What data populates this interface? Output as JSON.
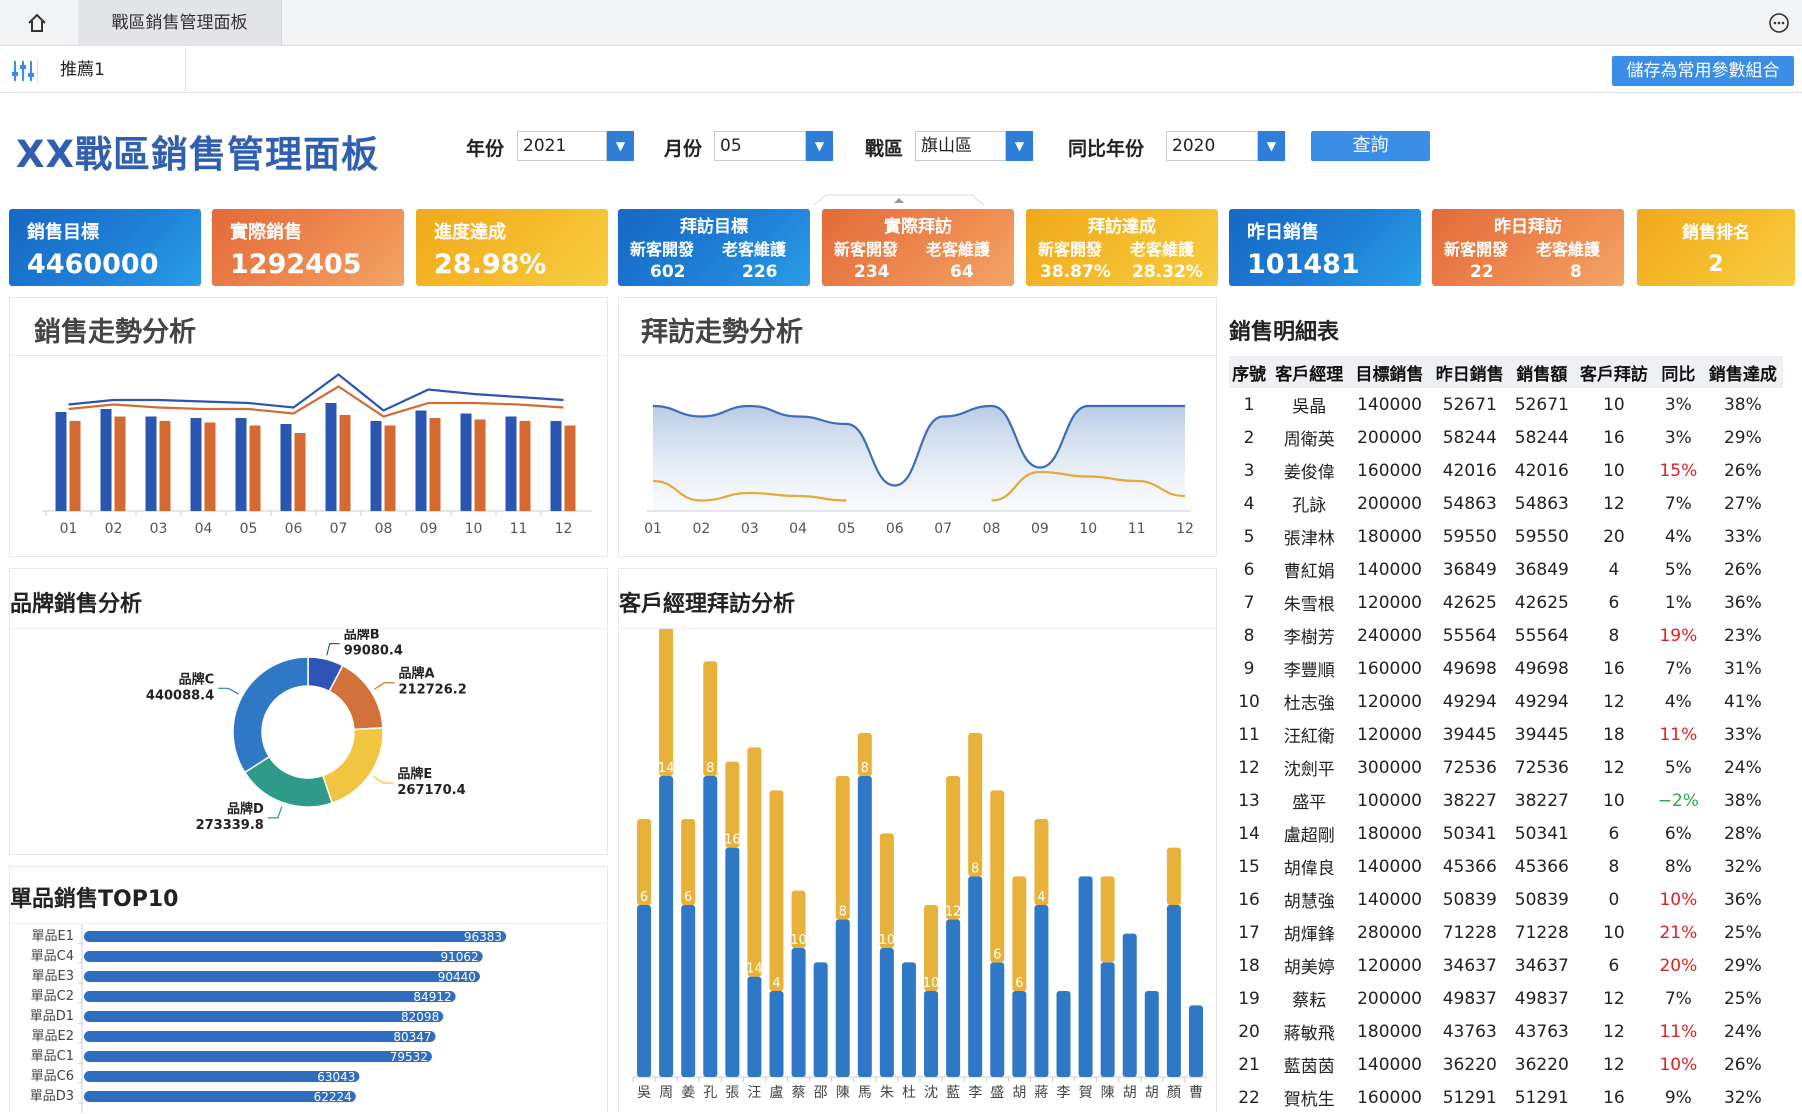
{
  "tabbar": {
    "tab_label": "戰區銷售管理面板"
  },
  "parambar": {
    "tab_label": "推薦1",
    "save_label": "儲存為常用參數組合"
  },
  "page_title": "XX戰區銷售管理面板",
  "filters": {
    "year_label": "年份",
    "year_value": "2021",
    "month_label": "月份",
    "month_value": "05",
    "region_label": "戰區",
    "region_value": "旗山區",
    "compare_label": "同比年份",
    "compare_value": "2020",
    "query_label": "查詢"
  },
  "kpis": {
    "target": {
      "title": "銷售目標",
      "value": "4460000"
    },
    "actual": {
      "title": "實際銷售",
      "value": "1292405"
    },
    "progress": {
      "title": "進度達成",
      "value": "28.98%"
    },
    "visit_target": {
      "title": "拜訪目標",
      "sub1": "新客開發",
      "sub2": "老客維護",
      "v1": "602",
      "v2": "226"
    },
    "visit_actual": {
      "title": "實際拜訪",
      "sub1": "新客開發",
      "sub2": "老客維護",
      "v1": "234",
      "v2": "64"
    },
    "visit_rate": {
      "title": "拜訪達成",
      "sub1": "新客開發",
      "sub2": "老客維護",
      "v1": "38.87%",
      "v2": "28.32%"
    },
    "yesterday": {
      "title": "昨日銷售",
      "value": "101481"
    },
    "yesterday_visit": {
      "title": "昨日拜訪",
      "sub1": "新客開發",
      "sub2": "老客維護",
      "v1": "22",
      "v2": "8"
    },
    "rank": {
      "title": "銷售排名",
      "value": "2"
    }
  },
  "colors": {
    "blue": "#2a55b0",
    "orange": "#d46a32",
    "gold": "#e8b23a",
    "barblue": "#2f78c6"
  },
  "panels": {
    "sales_trend": "銷售走勢分析",
    "visit_trend": "拜訪走勢分析",
    "brand": "品牌銷售分析",
    "manager_visit": "客戶經理拜訪分析",
    "top10": "單品銷售TOP10",
    "detail": "銷售明細表"
  },
  "chart_data": [
    {
      "type": "bar",
      "id": "sales_trend",
      "categories": [
        "01",
        "02",
        "03",
        "04",
        "05",
        "06",
        "07",
        "08",
        "09",
        "10",
        "11",
        "12"
      ],
      "series": [
        {
          "values": [
            66,
            68,
            63,
            62,
            62,
            58,
            72,
            60,
            67,
            65,
            63,
            60
          ]
        },
        {
          "values": [
            60,
            63,
            60,
            59,
            57,
            52,
            64,
            57,
            62,
            61,
            60,
            57
          ]
        }
      ],
      "lines": [
        {
          "values": [
            71,
            74,
            74,
            73,
            72,
            69,
            91,
            67,
            81,
            78,
            76,
            74
          ]
        },
        {
          "values": [
            68,
            71,
            69,
            68,
            68,
            65,
            83,
            63,
            72,
            72,
            71,
            69
          ]
        }
      ],
      "ylim": [
        0,
        100
      ]
    },
    {
      "type": "area",
      "id": "visit_trend",
      "categories": [
        "01",
        "02",
        "03",
        "04",
        "05",
        "06",
        "07",
        "08",
        "09",
        "10",
        "11",
        "12"
      ],
      "series": [
        {
          "values": [
            70,
            63,
            70,
            63,
            58,
            17,
            63,
            70,
            29,
            70,
            70,
            70
          ]
        },
        {
          "values": [
            20,
            7,
            12,
            10,
            7,
            null,
            null,
            7,
            26,
            23,
            20,
            10
          ]
        }
      ],
      "ylim": [
        0,
        100
      ]
    },
    {
      "type": "pie",
      "id": "brand",
      "labels": [
        "品牌B",
        "品牌A",
        "品牌E",
        "品牌D",
        "品牌C"
      ],
      "values": [
        99080.4,
        212726.2,
        267170.4,
        273339.8,
        440088.4
      ],
      "label_text": [
        "99080.4",
        "212726.2",
        "267170.4",
        "273339.8",
        "440088.4"
      ],
      "colors": [
        "#2f54b8",
        "#d2723a",
        "#f0c540",
        "#2e9a8a",
        "#2f78c6"
      ]
    },
    {
      "type": "bar",
      "id": "top10",
      "orientation": "horizontal",
      "categories": [
        "單品E1",
        "單品C4",
        "單品E3",
        "單品C2",
        "單品D1",
        "單品E2",
        "單品C1",
        "單品C6",
        "單品D3"
      ],
      "values": [
        96383,
        91062,
        90440,
        84912,
        82098,
        80347,
        79532,
        63043,
        62224
      ],
      "xlim": [
        0,
        100000
      ]
    },
    {
      "type": "bar",
      "id": "manager_visit",
      "stacked": true,
      "categories": [
        "吳",
        "周",
        "姜",
        "孔",
        "張",
        "汪",
        "盧",
        "蔡",
        "邵",
        "陳",
        "馬",
        "朱",
        "杜",
        "沈",
        "藍",
        "李",
        "盛",
        "胡",
        "蔣",
        "李",
        "賀",
        "陳",
        "胡",
        "胡",
        "顏",
        "曹"
      ],
      "series": [
        {
          "name": "",
          "values": [
            12,
            21,
            12,
            21,
            16,
            7,
            6,
            9,
            8,
            11,
            21,
            9,
            8,
            6,
            11,
            14,
            8,
            6,
            12,
            6,
            14,
            8,
            10,
            6,
            12,
            5
          ]
        },
        {
          "name": "",
          "values": [
            6,
            14,
            6,
            8,
            6,
            16,
            14,
            4,
            0,
            10,
            3,
            8,
            0,
            6,
            10,
            10,
            12,
            8,
            6,
            0,
            0,
            6,
            0,
            0,
            4,
            0
          ]
        }
      ],
      "data_labels": [
        "6",
        "14",
        "6",
        "8",
        "16",
        "14",
        "4",
        "10",
        "8",
        "8",
        "10",
        "10",
        "12",
        "8",
        "6",
        "6",
        "4"
      ],
      "ylim": [
        0,
        30
      ]
    }
  ],
  "detail_table": {
    "headers": [
      "序號",
      "客戶經理",
      "目標銷售",
      "昨日銷售",
      "銷售額",
      "客戶拜訪",
      "同比",
      "銷售達成"
    ],
    "rows": [
      [
        "1",
        "吳晶",
        "140000",
        "52671",
        "52671",
        "10",
        "3%",
        "38%"
      ],
      [
        "2",
        "周衛英",
        "200000",
        "58244",
        "58244",
        "16",
        "3%",
        "29%"
      ],
      [
        "3",
        "姜俊偉",
        "160000",
        "42016",
        "42016",
        "10",
        "15%",
        "26%"
      ],
      [
        "4",
        "孔詠",
        "200000",
        "54863",
        "54863",
        "12",
        "7%",
        "27%"
      ],
      [
        "5",
        "張津林",
        "180000",
        "59550",
        "59550",
        "20",
        "4%",
        "33%"
      ],
      [
        "6",
        "曹紅娟",
        "140000",
        "36849",
        "36849",
        "4",
        "5%",
        "26%"
      ],
      [
        "7",
        "朱雪根",
        "120000",
        "42625",
        "42625",
        "6",
        "1%",
        "36%"
      ],
      [
        "8",
        "李樹芳",
        "240000",
        "55564",
        "55564",
        "8",
        "19%",
        "23%"
      ],
      [
        "9",
        "李豐順",
        "160000",
        "49698",
        "49698",
        "16",
        "7%",
        "31%"
      ],
      [
        "10",
        "杜志強",
        "120000",
        "49294",
        "49294",
        "12",
        "4%",
        "41%"
      ],
      [
        "11",
        "汪紅衛",
        "120000",
        "39445",
        "39445",
        "18",
        "11%",
        "33%"
      ],
      [
        "12",
        "沈劍平",
        "300000",
        "72536",
        "72536",
        "12",
        "5%",
        "24%"
      ],
      [
        "13",
        "盛平",
        "100000",
        "38227",
        "38227",
        "10",
        "−2%",
        "38%"
      ],
      [
        "14",
        "盧超剛",
        "180000",
        "50341",
        "50341",
        "6",
        "6%",
        "28%"
      ],
      [
        "15",
        "胡偉良",
        "140000",
        "45366",
        "45366",
        "8",
        "8%",
        "32%"
      ],
      [
        "16",
        "胡慧強",
        "140000",
        "50839",
        "50839",
        "0",
        "10%",
        "36%"
      ],
      [
        "17",
        "胡煇鋒",
        "280000",
        "71228",
        "71228",
        "10",
        "21%",
        "25%"
      ],
      [
        "18",
        "胡美婷",
        "120000",
        "34637",
        "34637",
        "6",
        "20%",
        "29%"
      ],
      [
        "19",
        "蔡耘",
        "200000",
        "49837",
        "49837",
        "12",
        "7%",
        "25%"
      ],
      [
        "20",
        "蔣敏飛",
        "180000",
        "43763",
        "43763",
        "12",
        "11%",
        "24%"
      ],
      [
        "21",
        "藍茵茵",
        "140000",
        "36220",
        "36220",
        "12",
        "10%",
        "26%"
      ],
      [
        "22",
        "賀杭生",
        "160000",
        "51291",
        "51291",
        "16",
        "9%",
        "32%"
      ]
    ],
    "highlight": {
      "3": "red",
      "8": "red",
      "11": "red",
      "13": "green",
      "16": "red",
      "17": "red",
      "18": "red",
      "20": "red",
      "21": "red"
    }
  }
}
